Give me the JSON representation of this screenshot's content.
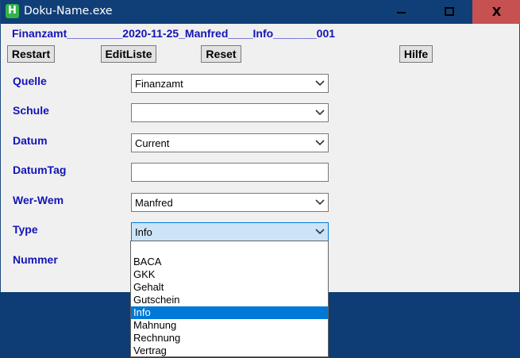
{
  "window": {
    "title": "Doku-Name.exe",
    "icon_letter": "H",
    "minimize_icon": "minimize-icon",
    "maximize_icon": "restore-icon",
    "close_label": "X"
  },
  "headline": "Finanzamt_________2020-11-25_Manfred____Info_______001",
  "toolbar": {
    "restart_label": "Restart",
    "editliste_label": "EditListe",
    "reset_label": "Reset",
    "hilfe_label": "Hilfe"
  },
  "form": {
    "quelle": {
      "label": "Quelle",
      "value": "Finanzamt"
    },
    "schule": {
      "label": "Schule",
      "value": ""
    },
    "datum": {
      "label": "Datum",
      "value": "Current"
    },
    "datumtag": {
      "label": "DatumTag",
      "value": ""
    },
    "werwem": {
      "label": "Wer-Wem",
      "value": "Manfred"
    },
    "type": {
      "label": "Type",
      "value": "Info"
    },
    "nummer": {
      "label": "Nummer"
    }
  },
  "type_dropdown": {
    "options": [
      "",
      "BACA",
      "GKK",
      "Gehalt",
      "Gutschein",
      "Info",
      "Mahnung",
      "Rechnung",
      "Vertrag"
    ],
    "selected": "Info"
  },
  "colors": {
    "label_blue": "#1414b8",
    "titlebar": "#103f78",
    "close_red": "#c75050",
    "selection": "#0078d7"
  }
}
